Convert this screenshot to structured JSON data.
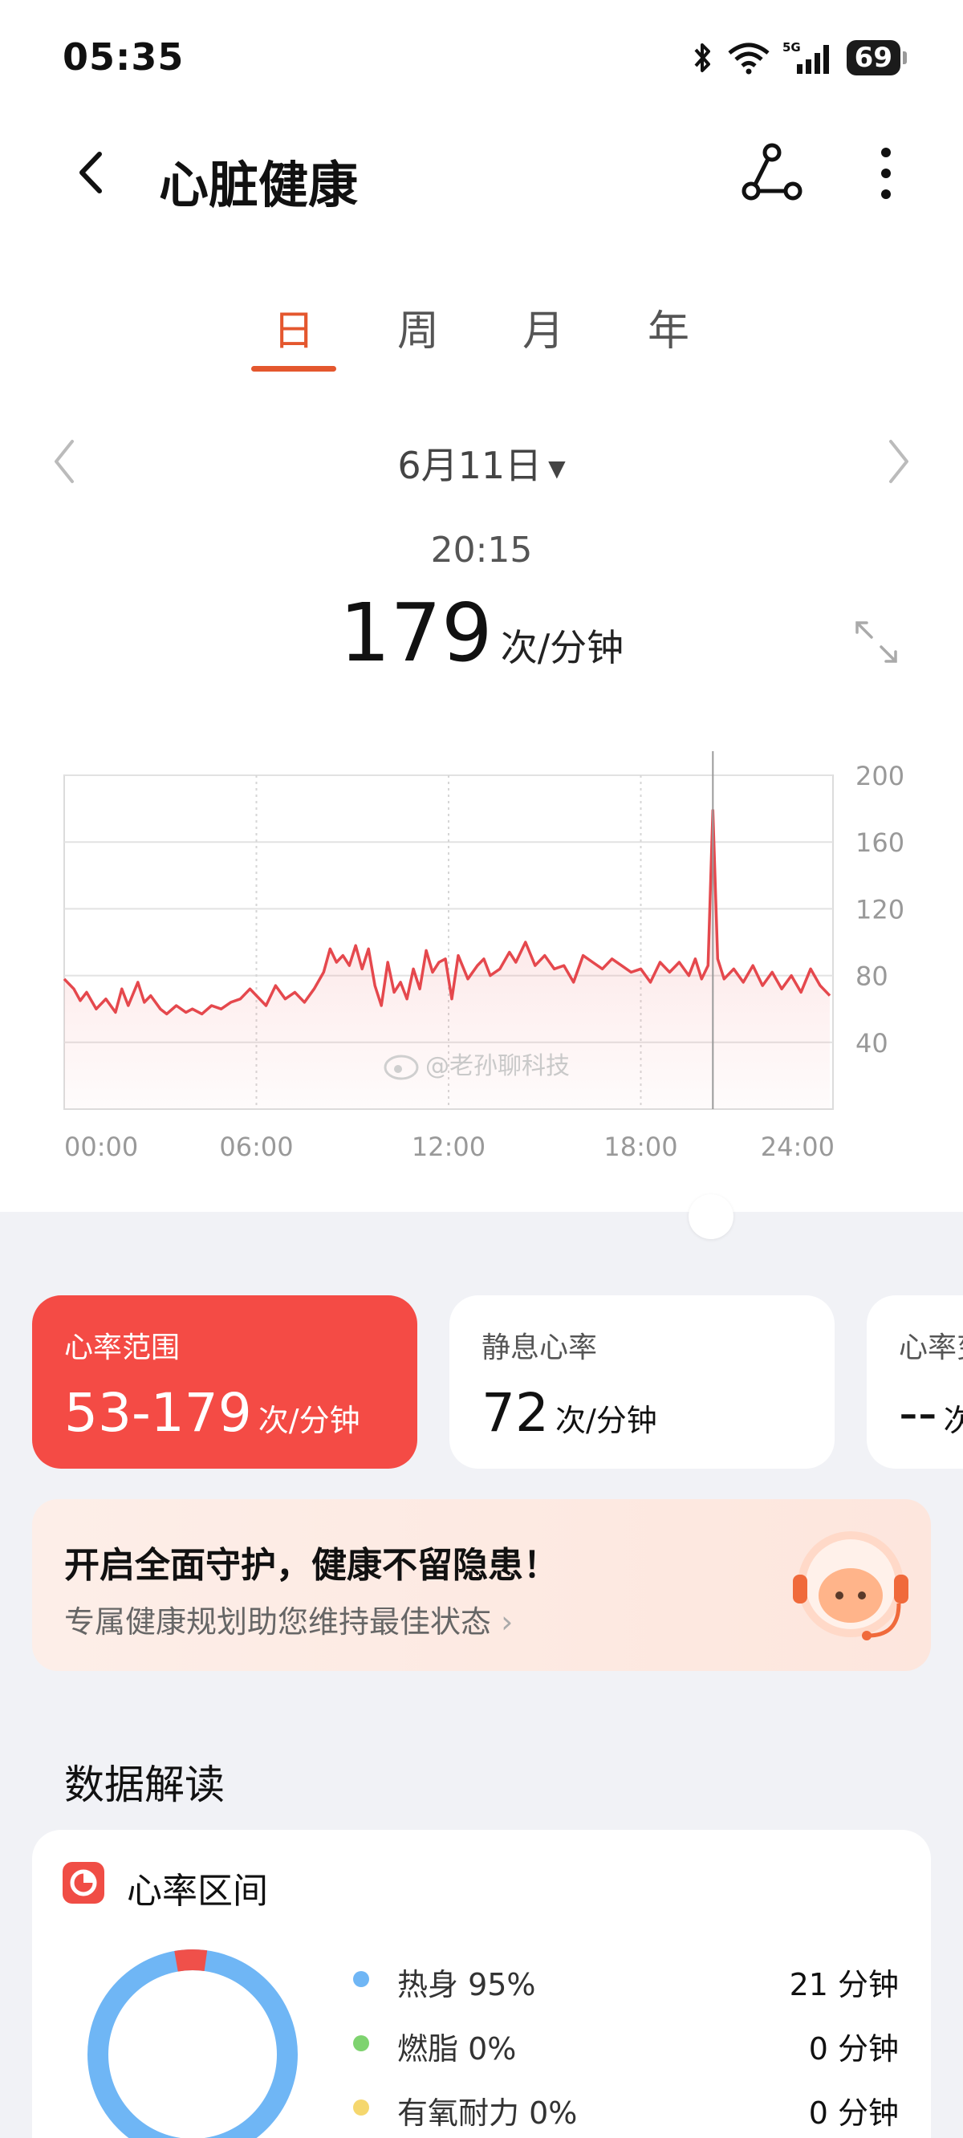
{
  "status_bar": {
    "time": "05:35",
    "battery": "69",
    "network": "5G"
  },
  "header": {
    "title": "心脏健康"
  },
  "tabs": [
    {
      "label": "日",
      "active": true
    },
    {
      "label": "周",
      "active": false
    },
    {
      "label": "月",
      "active": false
    },
    {
      "label": "年",
      "active": false
    }
  ],
  "date_selector": {
    "label": "6月11日"
  },
  "readout": {
    "time": "20:15",
    "value": "179",
    "unit": "次/分钟"
  },
  "watermark": "@老孙聊科技",
  "chart_data": {
    "type": "area",
    "x_labels": [
      "00:00",
      "06:00",
      "12:00",
      "18:00",
      "24:00"
    ],
    "y_ticks": [
      40,
      80,
      120,
      160,
      200
    ],
    "ylim": [
      0,
      200
    ],
    "grid": true,
    "accent": "#e5484d",
    "cursor_x_hours": 20.25,
    "series": [
      {
        "x": [
          0.0,
          0.3,
          0.5,
          0.7,
          1.0,
          1.3,
          1.6,
          1.8,
          2.0,
          2.3,
          2.5,
          2.7,
          3.0,
          3.2,
          3.5,
          3.8,
          4.0,
          4.3,
          4.6,
          4.9,
          5.2,
          5.5,
          5.8,
          6.0,
          6.3,
          6.6,
          6.9,
          7.2,
          7.5,
          7.8,
          8.1,
          8.3,
          8.5,
          8.7,
          8.9,
          9.1,
          9.3,
          9.5,
          9.7,
          9.9,
          10.1,
          10.3,
          10.5,
          10.7,
          10.9,
          11.1,
          11.3,
          11.5,
          11.7,
          11.9,
          12.1,
          12.3,
          12.6,
          12.9,
          13.1,
          13.3,
          13.6,
          13.9,
          14.1,
          14.4,
          14.7,
          15.0,
          15.3,
          15.6,
          15.9,
          16.2,
          16.5,
          16.8,
          17.1,
          17.4,
          17.7,
          18.0,
          18.3,
          18.6,
          18.9,
          19.2,
          19.5,
          19.7,
          19.9,
          20.1,
          20.25,
          20.4,
          20.6,
          20.9,
          21.2,
          21.5,
          21.8,
          22.1,
          22.4,
          22.7,
          23.0,
          23.3,
          23.6,
          23.9
        ],
        "y": [
          78,
          72,
          65,
          70,
          60,
          66,
          58,
          72,
          62,
          76,
          64,
          68,
          60,
          57,
          62,
          58,
          60,
          57,
          62,
          60,
          64,
          66,
          72,
          68,
          62,
          74,
          66,
          70,
          64,
          72,
          82,
          96,
          88,
          92,
          86,
          98,
          84,
          96,
          74,
          62,
          88,
          70,
          76,
          66,
          84,
          72,
          95,
          82,
          88,
          90,
          66,
          92,
          78,
          86,
          90,
          80,
          84,
          94,
          88,
          100,
          86,
          92,
          84,
          86,
          76,
          92,
          88,
          84,
          90,
          86,
          82,
          84,
          76,
          88,
          82,
          88,
          80,
          90,
          78,
          86,
          179,
          90,
          78,
          84,
          76,
          86,
          74,
          82,
          72,
          80,
          70,
          84,
          74,
          68
        ]
      }
    ]
  },
  "metric_cards": [
    {
      "title": "心率范围",
      "value": "53-179",
      "unit": "次/分钟"
    },
    {
      "title": "静息心率",
      "value": "72",
      "unit": "次/分钟"
    },
    {
      "title": "心率变",
      "value": "--",
      "unit": "次"
    }
  ],
  "promo": {
    "title": "开启全面守护，健康不留隐患！",
    "subtitle": "专属健康规划助您维持最佳状态"
  },
  "section_title": "数据解读",
  "zones": {
    "title": "心率区间",
    "items": [
      {
        "label": "热身 95%",
        "value": "21 分钟",
        "color": "#6fb6f5",
        "percent": 95
      },
      {
        "label": "燃脂 0%",
        "value": "0 分钟",
        "color": "#7ed36f",
        "percent": 0
      },
      {
        "label": "有氧耐力 0%",
        "value": "0 分钟",
        "color": "#f5d76e",
        "percent": 0
      }
    ],
    "other_color": "#f0504a",
    "other_percent": 5
  }
}
